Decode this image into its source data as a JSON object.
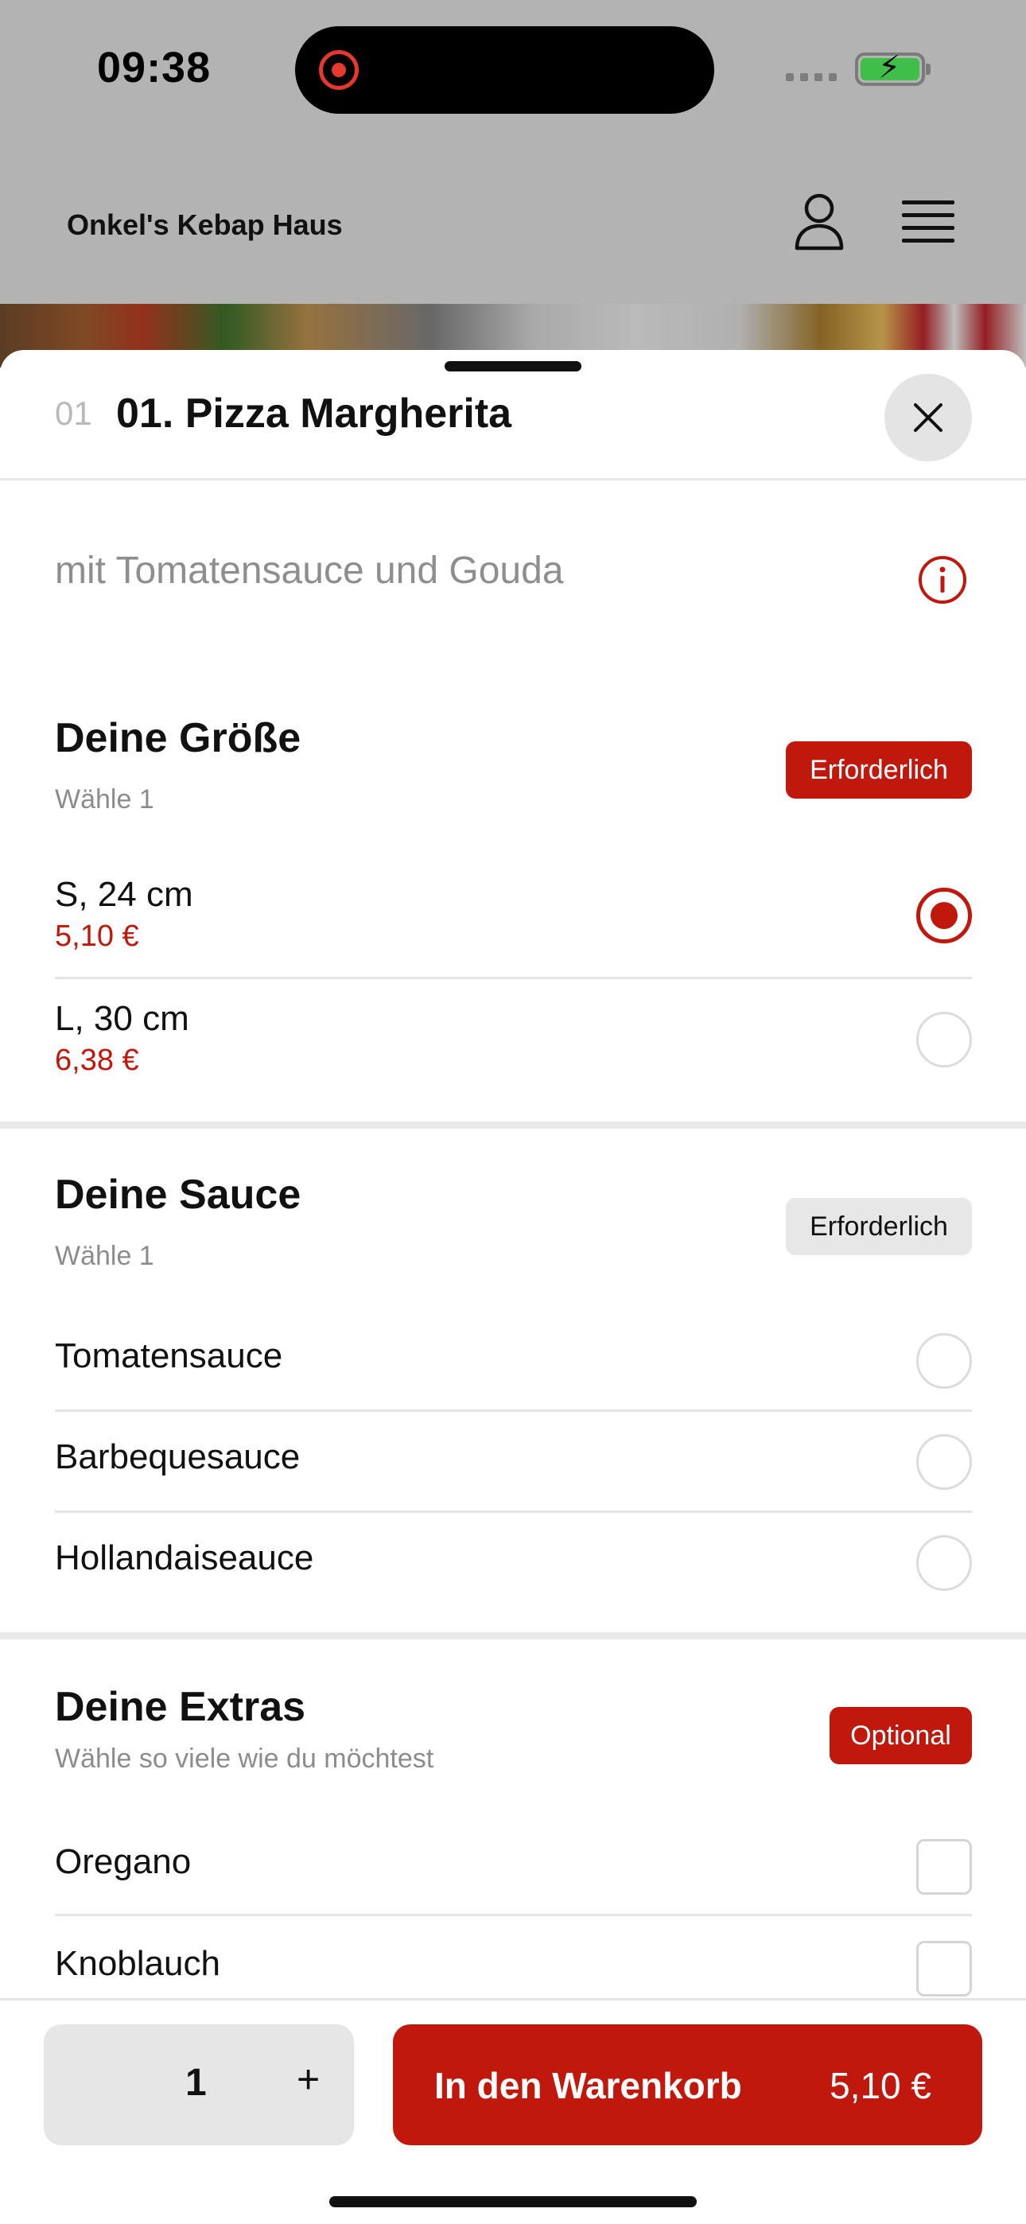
{
  "status_bar": {
    "time": "09:38"
  },
  "header": {
    "restaurant_name": "Onkel's Kebap Haus"
  },
  "sheet": {
    "item_number": "01",
    "item_title": "01. Pizza Margherita",
    "description": "mit Tomatensauce und Gouda"
  },
  "sections": {
    "size": {
      "title": "Deine Größe",
      "subtitle": "Wähle 1",
      "badge": "Erforderlich",
      "options": [
        {
          "name": "S, 24 cm",
          "price": "5,10 €",
          "selected": true
        },
        {
          "name": "L, 30 cm",
          "price": "6,38 €",
          "selected": false
        }
      ]
    },
    "sauce": {
      "title": "Deine Sauce",
      "subtitle": "Wähle 1",
      "badge": "Erforderlich",
      "options": [
        {
          "name": "Tomatensauce"
        },
        {
          "name": "Barbequesauce"
        },
        {
          "name": "Hollandaiseauce"
        }
      ]
    },
    "extras": {
      "title": "Deine Extras",
      "subtitle": "Wähle so viele wie du möchtest",
      "badge": "Optional",
      "options": [
        {
          "name": "Oregano"
        },
        {
          "name": "Knoblauch"
        }
      ]
    }
  },
  "action_bar": {
    "quantity": "1",
    "plus": "+",
    "cart_label": "In den Warenkorb",
    "cart_price": "5,10 €"
  },
  "colors": {
    "accent": "#c0180c",
    "overlay": "#b3b3b3",
    "badge_gray": "#e7e7e7"
  },
  "icons": [
    "record-indicator-icon",
    "battery-charging-icon",
    "user-icon",
    "hamburger-menu-icon",
    "close-icon",
    "info-icon"
  ]
}
